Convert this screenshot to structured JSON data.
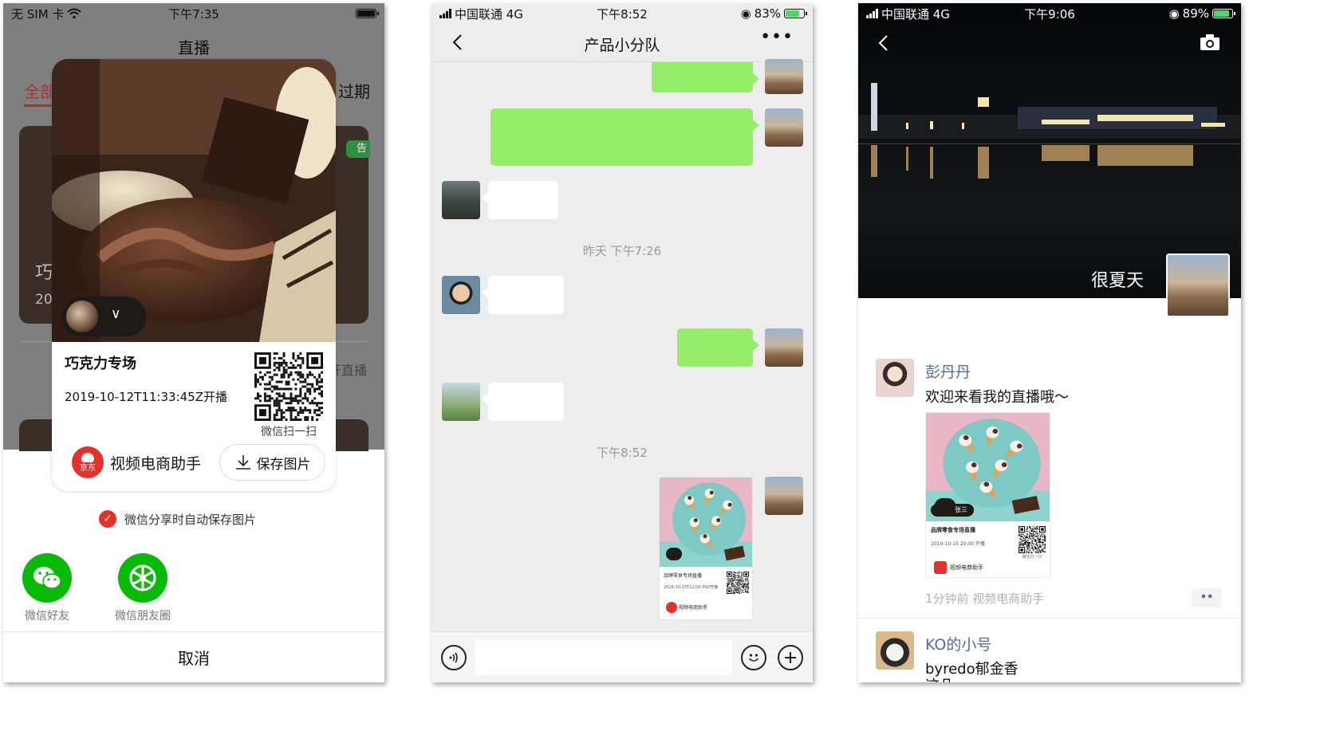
{
  "phone1": {
    "status": {
      "carrier": "无 SIM 卡",
      "time": "下午7:35"
    },
    "page_title": "直播",
    "tab_left": "全部",
    "tab_right": "过期",
    "bg_card_title": "巧",
    "bg_card_num": "20",
    "bg_card_tag": "告",
    "bg_live": "开直播",
    "poster": {
      "avatar_chevron": "∨",
      "title": "巧克力专场",
      "time": "2019-10-12T11:33:45Z开播",
      "qr_label": "微信扫一扫",
      "brand_logo_text": "京东",
      "brand_name": "视频电商助手",
      "save_label": "保存图片"
    },
    "autosave_label": "微信分享时自动保存图片",
    "share_friend": "微信好友",
    "share_moments": "微信朋友圈",
    "cancel": "取消"
  },
  "phone2": {
    "status": {
      "carrier": "中国联通 4G",
      "time": "下午8:52",
      "battery": "83%",
      "battery_level": 0.83
    },
    "chat_title": "产品小分队",
    "more": "•••",
    "time1": "昨天 下午7:26",
    "time2": "下午8:52",
    "card": {
      "title": "品牌零食专场直播",
      "time": "2019-10-15T12:00:39Z开播",
      "brand": "视频电商助手"
    }
  },
  "phone3": {
    "status": {
      "carrier": "中国联通 4G",
      "time": "下午9:06",
      "battery": "89%",
      "battery_level": 0.89
    },
    "cover_text": "很夏天",
    "post1": {
      "name": "彭丹丹",
      "text": "欢迎来看我的直播哦～",
      "card_badge": "张三",
      "card_title": "品牌零食专场直播",
      "card_time": "2019-10-15 20:00 开播",
      "card_qr_label": "微信扫一扫",
      "card_brand": "视频电商助手",
      "meta": "1分钟前  视频电商助手",
      "dots": "••"
    },
    "post2": {
      "name": "KO的小号",
      "text": "byredo郁金香",
      "clipped": "这几..."
    }
  },
  "colors": {
    "wechat_green": "#09bb07",
    "bubble_green": "#95ec69",
    "link_blue": "#576b95",
    "brand_red": "#e4312b"
  }
}
